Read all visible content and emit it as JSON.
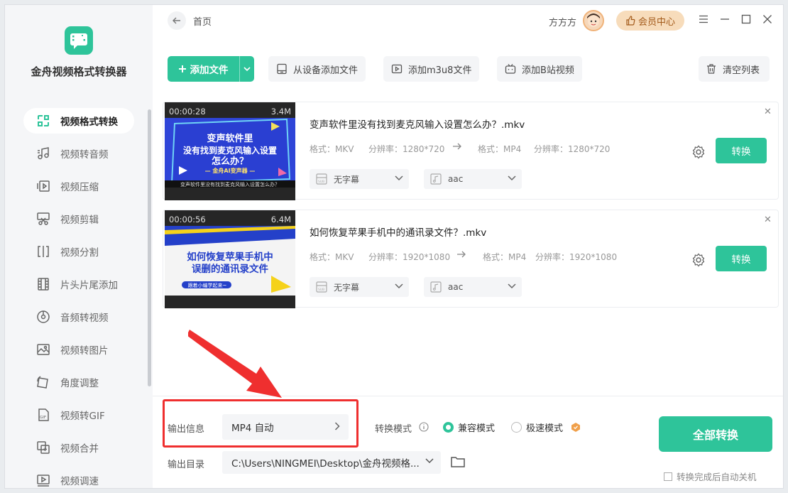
{
  "app": {
    "name": "金舟视频格式转换器"
  },
  "header": {
    "breadcrumb": "首页",
    "user_name": "方方方",
    "vip_label": "会员中心"
  },
  "sidebar": {
    "items": [
      {
        "label": "视频格式转换",
        "icon": "video-convert-icon",
        "active": true
      },
      {
        "label": "视频转音频",
        "icon": "music-note-icon"
      },
      {
        "label": "视频压缩",
        "icon": "compress-icon"
      },
      {
        "label": "视频剪辑",
        "icon": "scissors-icon"
      },
      {
        "label": "视频分割",
        "icon": "split-icon"
      },
      {
        "label": "片头片尾添加",
        "icon": "film-strip-icon"
      },
      {
        "label": "音频转视频",
        "icon": "disc-icon"
      },
      {
        "label": "视频转图片",
        "icon": "image-icon"
      },
      {
        "label": "角度调整",
        "icon": "rotate-icon"
      },
      {
        "label": "视频转GIF",
        "icon": "gif-icon"
      },
      {
        "label": "视频合并",
        "icon": "merge-icon"
      },
      {
        "label": "视频调速",
        "icon": "speed-icon"
      }
    ]
  },
  "toolbar": {
    "add_file": "添加文件",
    "from_device": "从设备添加文件",
    "add_m3u8": "添加m3u8文件",
    "add_bilibili": "添加B站视频",
    "clear_list": "清空列表"
  },
  "files": [
    {
      "duration": "00:00:28",
      "size": "3.4M",
      "title": "变声软件里没有找到麦克风输入设置怎么办？.mkv",
      "src_format_label": "格式：MKV",
      "src_res_label": "分辨率：1280*720",
      "dst_format_label": "格式：MP4",
      "dst_res_label": "分辨率：1280*720",
      "subtitle": "无字幕",
      "audio": "aac",
      "convert_label": "转换",
      "thumb_lines": [
        "变声软件里",
        "没有找到麦克风输入设置",
        "怎么办？",
        "— 金舟AI变声器 —",
        "变声软件里没有找到麦克风输入设置怎么办？"
      ]
    },
    {
      "duration": "00:00:56",
      "size": "6.4M",
      "title": "如何恢复苹果手机中的通讯录文件？.mkv",
      "src_format_label": "格式：MKV",
      "src_res_label": "分辨率：1920*1080",
      "dst_format_label": "格式：MP4",
      "dst_res_label": "分辨率：1920*1080",
      "subtitle": "无字幕",
      "audio": "aac",
      "convert_label": "转换",
      "thumb_lines": [
        "如何恢复苹果手机中",
        "误删的通讯录文件",
        "跟着小编学起来~"
      ]
    }
  ],
  "output": {
    "info_label": "输出信息",
    "format_value": "MP4 自动",
    "dir_label": "输出目录",
    "dir_value": "C:\\Users\\NINGMEI\\Desktop\\金舟视频格...",
    "mode_label": "转换模式",
    "mode_compat": "兼容模式",
    "mode_fast": "极速模式",
    "all_convert": "全部转换",
    "auto_shutdown": "转换完成后自动关机"
  },
  "colors": {
    "accent": "#2ec49a",
    "annotation": "#ef2f2f",
    "vip_bg": "#f7dcbb"
  }
}
